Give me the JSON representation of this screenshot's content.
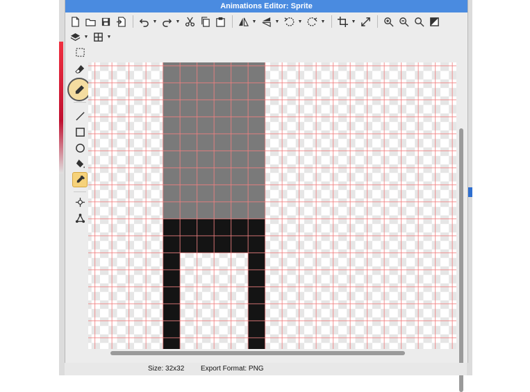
{
  "window": {
    "title": "Animations Editor: Sprite"
  },
  "toolbar": {
    "row1": [
      "new-file-icon",
      "open-folder-icon",
      "save-icon",
      "export-icon",
      "undo-icon",
      "redo-icon",
      "cut-icon",
      "copy-icon",
      "paste-icon",
      "flip-horizontal-icon",
      "flip-vertical-icon",
      "rotate-left-icon",
      "rotate-right-icon",
      "crop-icon",
      "resize-icon",
      "zoom-in-icon",
      "zoom-out-icon",
      "zoom-fit-icon",
      "invert-icon"
    ],
    "row2": [
      "layers-icon",
      "grid-icon"
    ]
  },
  "tools": [
    "select-rectangle-icon",
    "eraser-icon",
    "pencil-icon",
    "line-icon",
    "rectangle-icon",
    "ellipse-icon",
    "paint-bucket-icon",
    "eyedropper-icon",
    "move-point-icon",
    "transform-icon"
  ],
  "active_tool": "eyedropper-icon",
  "status": {
    "size": "Size: 32x32",
    "export_format": "Export Format: PNG"
  },
  "colors": {
    "accent": "#4a8be0",
    "grid": "#f08080",
    "gray_fill": "#7a7a7a",
    "black_fill": "#141414",
    "active_tool": "#f6d27a"
  }
}
